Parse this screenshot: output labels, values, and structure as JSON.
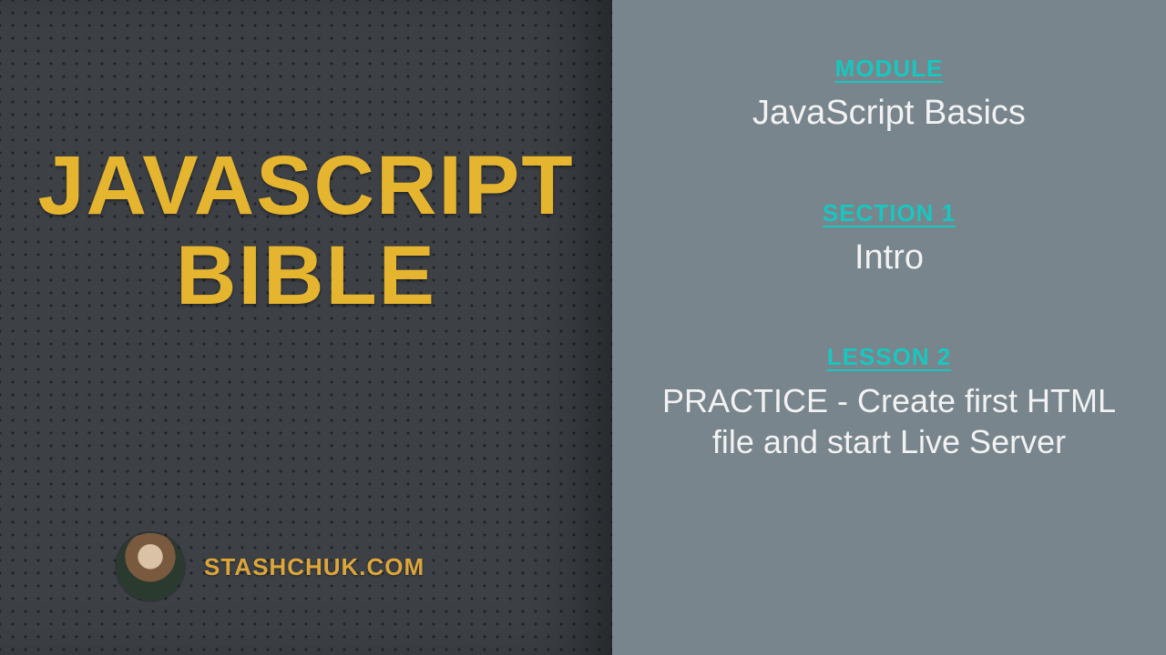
{
  "left": {
    "title_line1": "JAVASCRIPT",
    "title_line2": "BIBLE",
    "site": "STASHCHUK.COM"
  },
  "right": {
    "module_label": "MODULE",
    "module_value": "JavaScript Basics",
    "section_label": "SECTION 1",
    "section_value": "Intro",
    "lesson_label": "LESSON 2",
    "lesson_value": "PRACTICE - Create first HTML file and start Live Server"
  },
  "colors": {
    "accent_yellow": "#e6b52f",
    "accent_teal": "#18c7bf",
    "left_bg": "#3d4146",
    "right_bg": "#78858d"
  }
}
